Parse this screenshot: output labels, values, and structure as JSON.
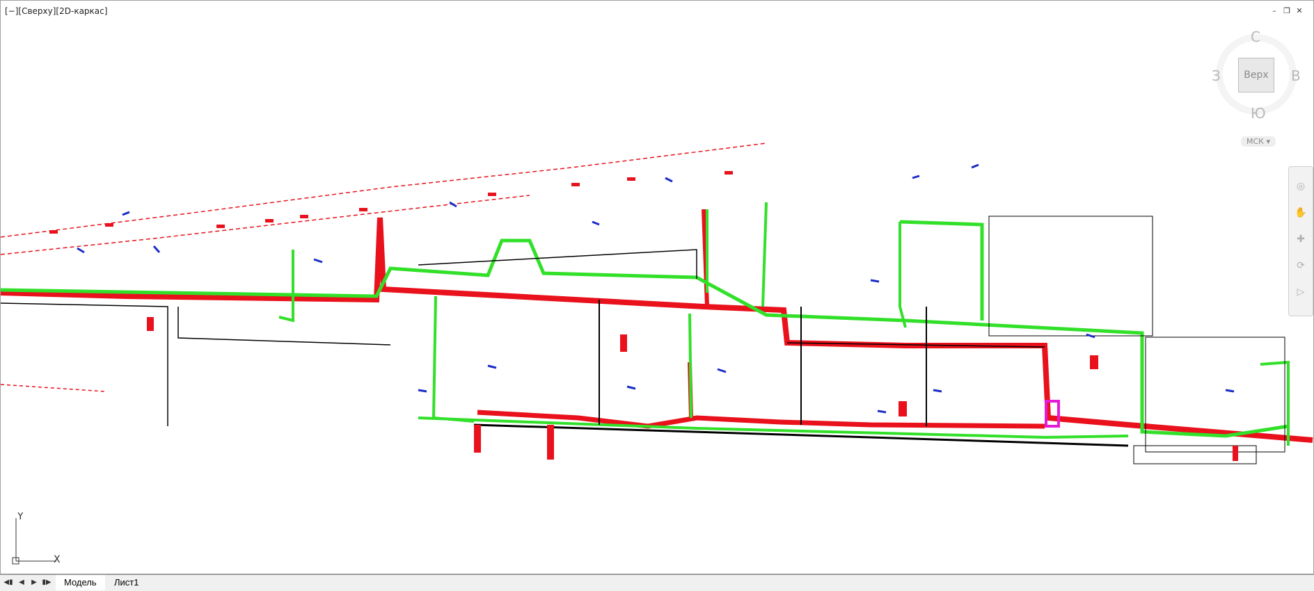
{
  "viewport": {
    "label": "[−][Сверху][2D-каркас]",
    "controls": [
      "minimize-icon",
      "restore-icon",
      "close-icon"
    ]
  },
  "viewcube": {
    "north": "С",
    "south": "Ю",
    "west": "З",
    "east": "В",
    "face": "Верх",
    "wcs_label": "МСК"
  },
  "navbar": {
    "tools": [
      "steering-wheel-icon",
      "pan-icon",
      "zoom-icon",
      "orbit-icon",
      "showmotion-icon"
    ]
  },
  "ucs": {
    "x_label": "X",
    "y_label": "Y"
  },
  "tabs": {
    "items": [
      {
        "label": "Модель",
        "active": true
      },
      {
        "label": "Лист1",
        "active": false
      }
    ]
  },
  "colors": {
    "red_line": "#e8111c",
    "green_line": "#32e02a",
    "blue_line": "#1a2cc8",
    "black_line": "#000000",
    "magenta": "#e619d6"
  }
}
